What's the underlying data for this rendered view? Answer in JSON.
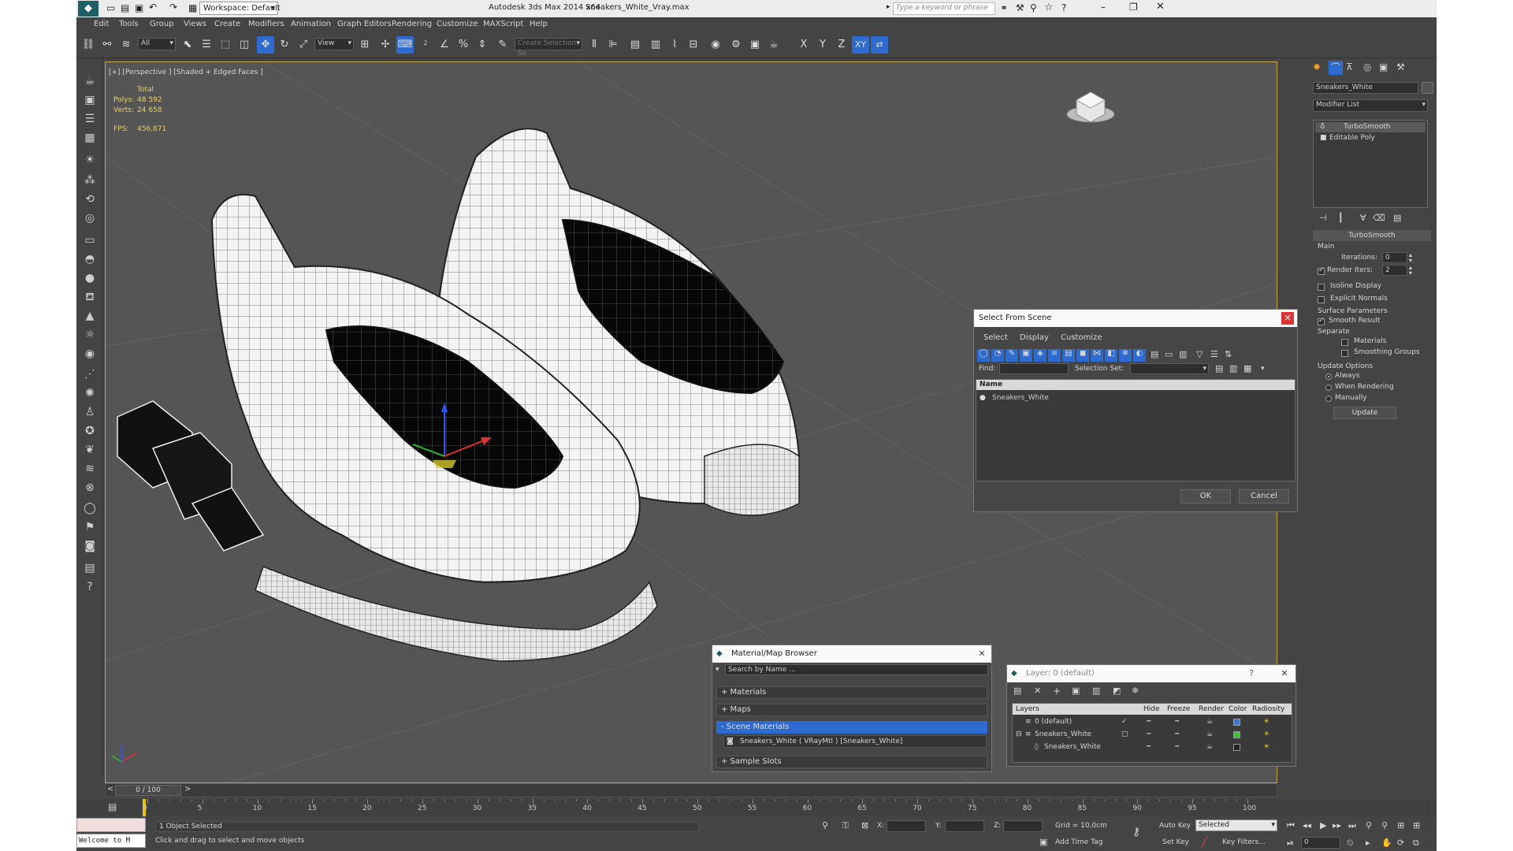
{
  "title_bar": {
    "workspace_label": "Workspace: Default",
    "app_title": "Autodesk 3ds Max  2014 x64",
    "file_name": "Sneakers_White_Vray.max",
    "search_placeholder": "Type a keyword or phrase"
  },
  "menu": [
    "Edit",
    "Tools",
    "Group",
    "Views",
    "Create",
    "Modifiers",
    "Animation",
    "Graph Editors",
    "Rendering",
    "Customize",
    "MAXScript",
    "Help"
  ],
  "toolbar": {
    "filter_value": "All",
    "ref_coord_value": "View",
    "create_selection_set_placeholder": "Create Selection Se",
    "axis_x": "X",
    "axis_y": "Y",
    "axis_z": "Z",
    "axis_xy": "XY"
  },
  "viewport": {
    "label": "[+] [Perspective ] [Shaded + Edged Faces ]",
    "stats_header": "Total",
    "polys_label": "Polys:",
    "polys_value": "48 592",
    "verts_label": "Verts:",
    "verts_value": "24 658",
    "fps_label": "FPS:",
    "fps_value": "456,871"
  },
  "command_panel": {
    "object_name": "Sneakers_White",
    "modifier_list_label": "Modifier List",
    "stack": [
      "TurboSmooth",
      "Editable Poly"
    ],
    "rollout_title": "TurboSmooth",
    "main_label": "Main",
    "iterations_label": "Iterations:",
    "iterations_value": "0",
    "render_iters_label": "Render Iters:",
    "render_iters_value": "2",
    "isoline_label": "Isoline Display",
    "explicit_normals_label": "Explicit Normals",
    "surface_params_label": "Surface Parameters",
    "smooth_result_label": "Smooth Result",
    "separate_label": "Separate",
    "materials_label": "Materials",
    "smoothing_groups_label": "Smoothing Groups",
    "update_options_label": "Update Options",
    "always_label": "Always",
    "when_rendering_label": "When Rendering",
    "manually_label": "Manually",
    "update_button": "Update"
  },
  "select_from_scene": {
    "title": "Select From Scene",
    "menu": [
      "Select",
      "Display",
      "Customize"
    ],
    "find_label": "Find:",
    "selection_set_label": "Selection Set:",
    "column_name": "Name",
    "items": [
      "Sneakers_White"
    ],
    "ok": "OK",
    "cancel": "Cancel"
  },
  "material_browser": {
    "title": "Material/Map Browser",
    "search_placeholder": "Search by Name ...",
    "groups": [
      "+ Materials",
      "+ Maps",
      "- Scene Materials"
    ],
    "scene_material": "Sneakers_White  ( VRayMtl ) [Sneakers_White]",
    "sample_slots": "+ Sample Slots"
  },
  "layer_dialog": {
    "title": "Layer: 0 (default)",
    "help": "?",
    "columns": [
      "Layers",
      "Hide",
      "Freeze",
      "Render",
      "Color",
      "Radiosity"
    ],
    "rows": [
      {
        "name": "0 (default)",
        "color": "#3a7ad4"
      },
      {
        "name": "Sneakers_White",
        "color": "#3cc23c"
      },
      {
        "name": "Sneakers_White",
        "color": "#222222"
      }
    ]
  },
  "timeline": {
    "frame_label": "0 / 100",
    "ticks": [
      "0",
      "5",
      "10",
      "15",
      "20",
      "25",
      "30",
      "35",
      "40",
      "45",
      "50",
      "55",
      "60",
      "65",
      "70",
      "75",
      "80",
      "85",
      "90",
      "95",
      "100"
    ]
  },
  "status": {
    "welcome": "Welcome to M",
    "selection_info": "1 Object Selected",
    "prompt": "Click and drag to select and move objects",
    "x_label": "X:",
    "y_label": "Y:",
    "z_label": "Z:",
    "grid": "Grid = 10,0cm",
    "add_time_tag": "Add Time Tag",
    "auto_key": "Auto Key",
    "auto_key_value": "Selected",
    "set_key": "Set Key",
    "key_filters": "Key Filters...",
    "frame_value": "0"
  }
}
